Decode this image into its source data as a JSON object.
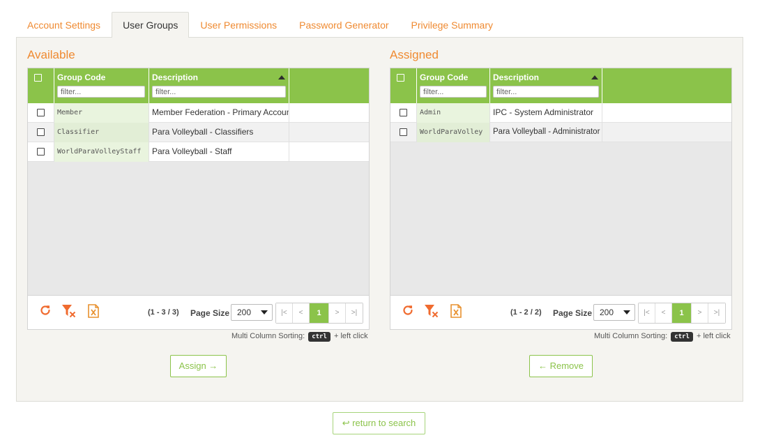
{
  "tabs": [
    {
      "label": "Account Settings",
      "active": false
    },
    {
      "label": "User Groups",
      "active": true
    },
    {
      "label": "User Permissions",
      "active": false
    },
    {
      "label": "Password Generator",
      "active": false
    },
    {
      "label": "Privilege Summary",
      "active": false
    }
  ],
  "available": {
    "title": "Available",
    "columns": {
      "code": "Group Code",
      "description": "Description"
    },
    "filter_placeholder": "filter...",
    "rows": [
      {
        "code": "Member",
        "description": "Member Federation - Primary Account"
      },
      {
        "code": "Classifier",
        "description": "Para Volleyball - Classifiers"
      },
      {
        "code": "WorldParaVolleyStaff",
        "description": "Para Volleyball - Staff"
      }
    ],
    "range": "(1 - 3 / 3)",
    "page_size_label": "Page Size",
    "page_size": "200",
    "pager": {
      "first": "|<",
      "prev": "<",
      "current": "1",
      "next": ">",
      "last": ">|"
    },
    "sort_hint_pre": "Multi Column Sorting:",
    "sort_hint_key": "ctrl",
    "sort_hint_post": "+ left click",
    "action": "Assign →"
  },
  "assigned": {
    "title": "Assigned",
    "columns": {
      "code": "Group Code",
      "description": "Description"
    },
    "filter_placeholder": "filter...",
    "rows": [
      {
        "code": "Admin",
        "description": "IPC - System Administrator"
      },
      {
        "code": "WorldParaVolley",
        "description": "Para Volleyball - Administrator"
      }
    ],
    "range": "(1 - 2 / 2)",
    "page_size_label": "Page Size",
    "page_size": "200",
    "pager": {
      "first": "|<",
      "prev": "<",
      "current": "1",
      "next": ">",
      "last": ">|"
    },
    "sort_hint_pre": "Multi Column Sorting:",
    "sort_hint_key": "ctrl",
    "sort_hint_post": "+ left click",
    "action": "← Remove"
  },
  "return_label": "↩ return to search",
  "colors": {
    "accent": "#ef8a31",
    "green": "#8bc34a",
    "excel": "#e8912f",
    "refresh": "#f06b2f"
  }
}
